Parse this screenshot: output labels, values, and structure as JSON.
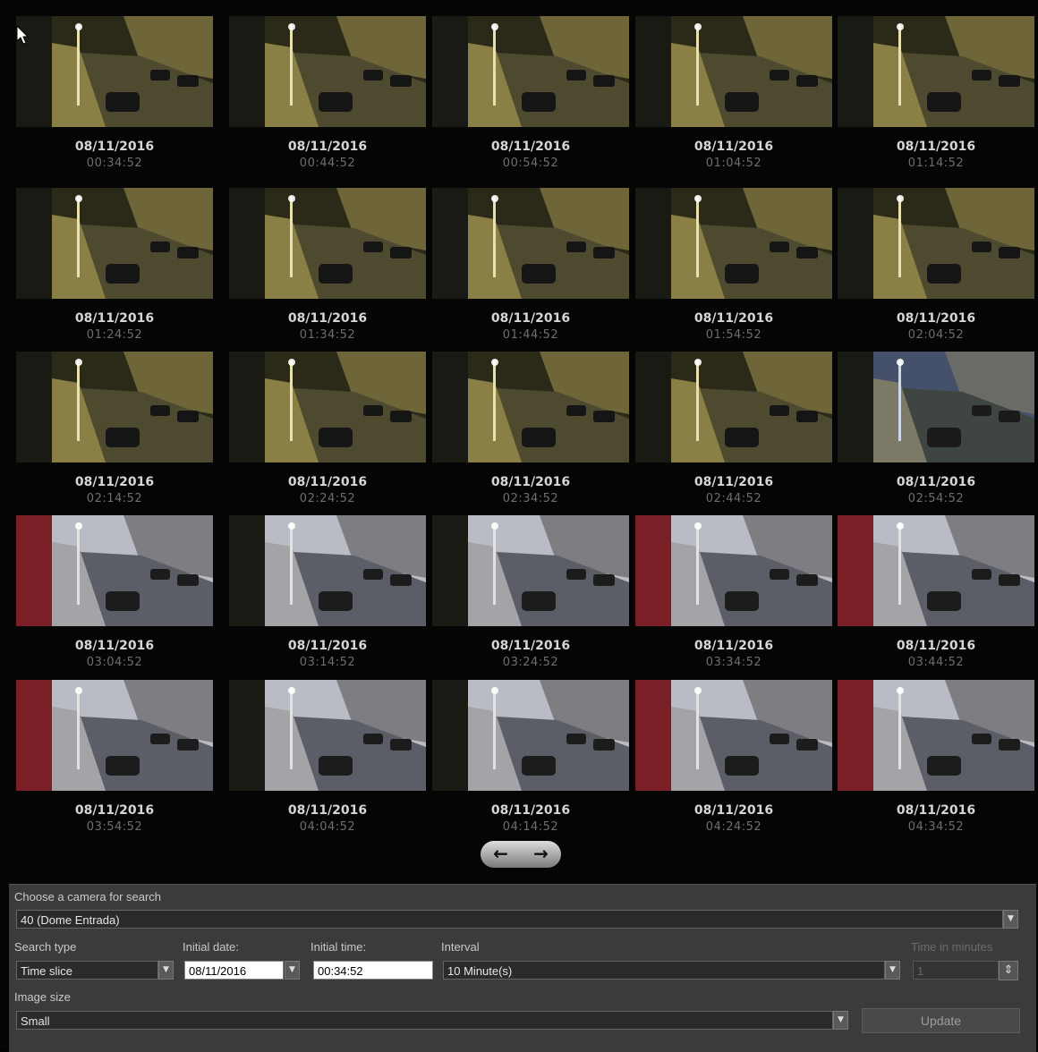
{
  "thumbnails": [
    {
      "date": "08/11/2016",
      "time": "00:34:52",
      "scene": "night"
    },
    {
      "date": "08/11/2016",
      "time": "00:44:52",
      "scene": "night"
    },
    {
      "date": "08/11/2016",
      "time": "00:54:52",
      "scene": "night"
    },
    {
      "date": "08/11/2016",
      "time": "01:04:52",
      "scene": "night"
    },
    {
      "date": "08/11/2016",
      "time": "01:14:52",
      "scene": "night"
    },
    {
      "date": "08/11/2016",
      "time": "01:24:52",
      "scene": "night"
    },
    {
      "date": "08/11/2016",
      "time": "01:34:52",
      "scene": "night"
    },
    {
      "date": "08/11/2016",
      "time": "01:44:52",
      "scene": "night"
    },
    {
      "date": "08/11/2016",
      "time": "01:54:52",
      "scene": "night"
    },
    {
      "date": "08/11/2016",
      "time": "02:04:52",
      "scene": "night"
    },
    {
      "date": "08/11/2016",
      "time": "02:14:52",
      "scene": "night"
    },
    {
      "date": "08/11/2016",
      "time": "02:24:52",
      "scene": "night"
    },
    {
      "date": "08/11/2016",
      "time": "02:34:52",
      "scene": "night"
    },
    {
      "date": "08/11/2016",
      "time": "02:44:52",
      "scene": "night"
    },
    {
      "date": "08/11/2016",
      "time": "02:54:52",
      "scene": "dawn"
    },
    {
      "date": "08/11/2016",
      "time": "03:04:52",
      "scene": "day"
    },
    {
      "date": "08/11/2016",
      "time": "03:14:52",
      "scene": "day"
    },
    {
      "date": "08/11/2016",
      "time": "03:24:52",
      "scene": "day"
    },
    {
      "date": "08/11/2016",
      "time": "03:34:52",
      "scene": "day"
    },
    {
      "date": "08/11/2016",
      "time": "03:44:52",
      "scene": "day"
    },
    {
      "date": "08/11/2016",
      "time": "03:54:52",
      "scene": "day"
    },
    {
      "date": "08/11/2016",
      "time": "04:04:52",
      "scene": "day"
    },
    {
      "date": "08/11/2016",
      "time": "04:14:52",
      "scene": "day"
    },
    {
      "date": "08/11/2016",
      "time": "04:24:52",
      "scene": "day"
    },
    {
      "date": "08/11/2016",
      "time": "04:34:52",
      "scene": "day"
    }
  ],
  "nav": {
    "prev_icon": "arrow-left-icon",
    "next_icon": "arrow-right-icon",
    "prev_glyph": "←",
    "next_glyph": "→"
  },
  "form": {
    "camera_label": "Choose a camera for search",
    "camera_value": "40 (Dome Entrada)",
    "search_type_label": "Search type",
    "search_type_value": "Time slice",
    "initial_date_label": "Initial date:",
    "initial_date_value": "08/11/2016",
    "initial_time_label": "Initial time:",
    "initial_time_value": "00:34:52",
    "interval_label": "Interval",
    "interval_value": "10 Minute(s)",
    "time_in_minutes_label": "Time in minutes",
    "time_in_minutes_value": "1",
    "image_size_label": "Image size",
    "image_size_value": "Small",
    "update_label": "Update"
  },
  "colors": {
    "panel": "#3b3b3b",
    "background": "#050505",
    "date_text": "#d6d6d6",
    "time_text": "#6e6e6e"
  }
}
